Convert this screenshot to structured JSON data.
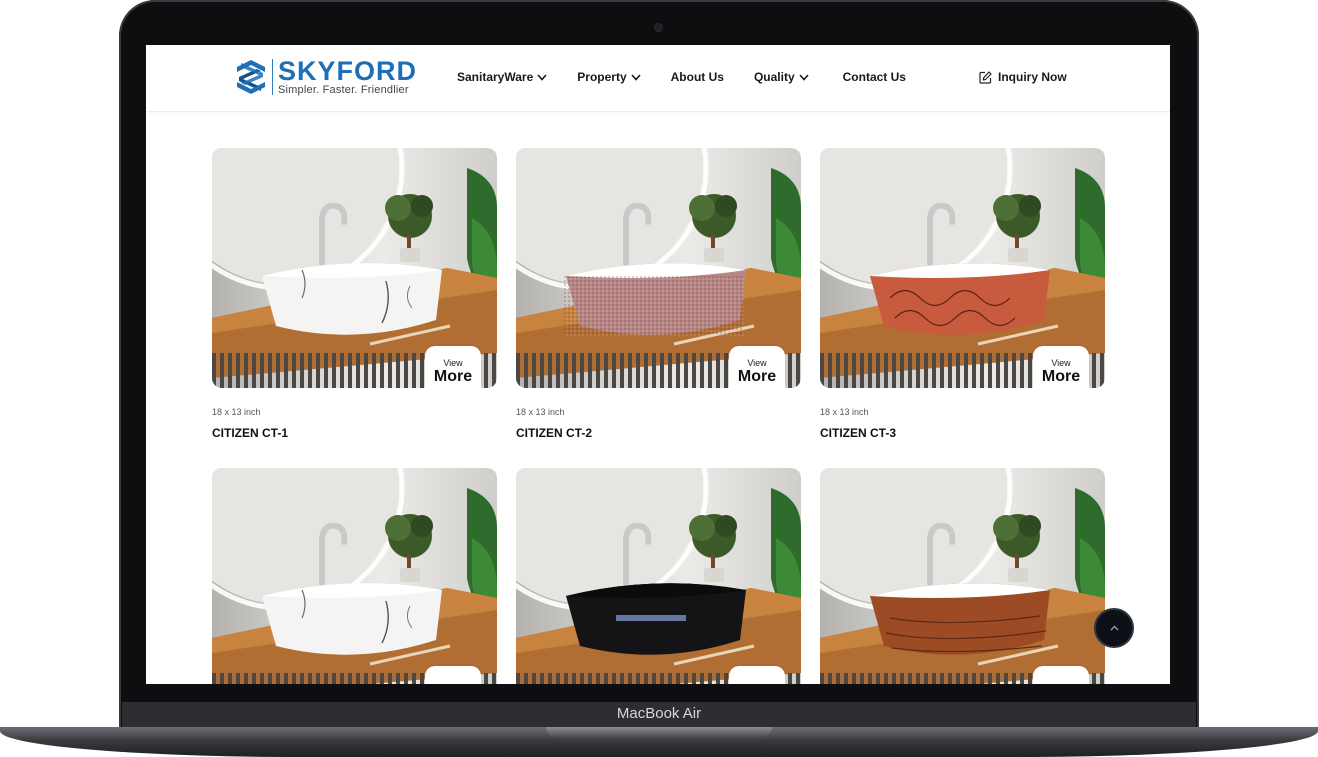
{
  "device": {
    "label": "MacBook Air"
  },
  "brand": {
    "name": "SKYFORD",
    "tagline": "Simpler. Faster. Friendlier",
    "accent": "#1d6fb7"
  },
  "nav": {
    "items": [
      {
        "label": "SanitaryWare",
        "dropdown": true
      },
      {
        "label": "Property",
        "dropdown": true
      },
      {
        "label": "About Us",
        "dropdown": false
      },
      {
        "label": "Quality",
        "dropdown": true
      },
      {
        "label": "Contact Us",
        "dropdown": false
      }
    ],
    "cta": {
      "label": "Inquiry Now",
      "icon": "edit-icon"
    }
  },
  "products": [
    {
      "size": "18 x 13 inch",
      "name": "CITIZEN CT-1",
      "view_top": "View",
      "view_bottom": "More",
      "basin_color": "#f4f4f3",
      "pattern": "white-marble"
    },
    {
      "size": "18 x 13 inch",
      "name": "CITIZEN CT-2",
      "view_top": "View",
      "view_bottom": "More",
      "basin_color": "#b98686",
      "pattern": "speckled-pink"
    },
    {
      "size": "18 x 13 inch",
      "name": "CITIZEN CT-3",
      "view_top": "View",
      "view_bottom": "More",
      "basin_color": "#c85a3d",
      "pattern": "red-swirl"
    },
    {
      "size": "",
      "name": "",
      "view_top": "",
      "view_bottom": "",
      "basin_color": "#f4f4f4",
      "pattern": "white-marble-veined"
    },
    {
      "size": "",
      "name": "",
      "view_top": "",
      "view_bottom": "",
      "basin_color": "#141416",
      "pattern": "black-marble"
    },
    {
      "size": "",
      "name": "",
      "view_top": "",
      "view_bottom": "",
      "basin_color": "#9c4b24",
      "pattern": "wood-grain"
    }
  ],
  "scroll_top": {
    "icon": "chevron-up-icon"
  }
}
